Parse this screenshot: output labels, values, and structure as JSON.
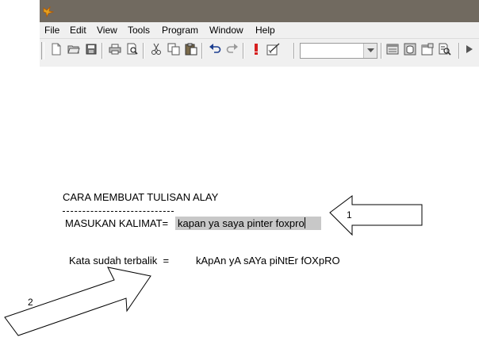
{
  "window": {
    "title_bar_color": "#716a60",
    "app_icon": "foxpro-fox-icon"
  },
  "menu": {
    "items": [
      "File",
      "Edit",
      "View",
      "Tools",
      "Program",
      "Window",
      "Help"
    ]
  },
  "toolbar": {
    "icons": [
      "new-file-icon",
      "open-folder-icon",
      "save-icon",
      "print-icon",
      "print-preview-icon",
      "cut-icon",
      "copy-icon",
      "paste-icon",
      "undo-icon",
      "redo-icon",
      "run-icon",
      "modify-icon",
      "command-window-icon",
      "data-session-icon",
      "form-designer-icon",
      "code-references-icon"
    ],
    "combo_value": ""
  },
  "content": {
    "heading": "CARA MEMBUAT TULISAN ALAY",
    "divider": "----------------------------------------",
    "input_label": "MASUKAN KALIMAT=",
    "input_value": "kapan ya saya pinter foxpro",
    "result_label": "Kata sudah terbalik  =",
    "result_value": "kApAn yA sAYa piNtEr fOXpRO"
  },
  "annotations": {
    "arrow1_label": "1",
    "arrow2_label": "2"
  }
}
